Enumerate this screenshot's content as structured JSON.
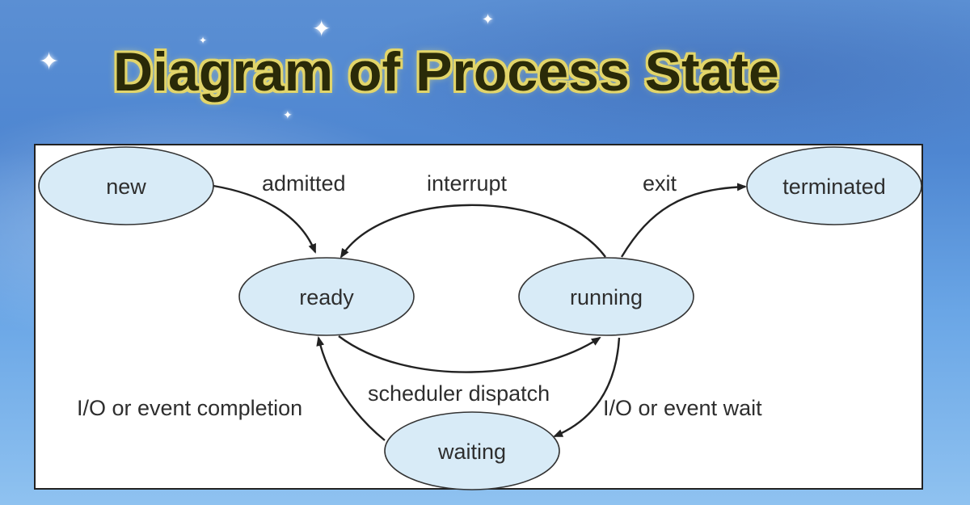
{
  "slide": {
    "title": "Diagram of Process State"
  },
  "diagram": {
    "states": {
      "new": "new",
      "ready": "ready",
      "running": "running",
      "waiting": "waiting",
      "terminated": "terminated"
    },
    "transitions": {
      "admitted": "admitted",
      "interrupt": "interrupt",
      "exit": "exit",
      "scheduler_dispatch": "scheduler dispatch",
      "io_event_completion": "I/O or event completion",
      "io_event_wait": "I/O or event wait"
    }
  },
  "icons": [
    "sparkle-icon"
  ]
}
